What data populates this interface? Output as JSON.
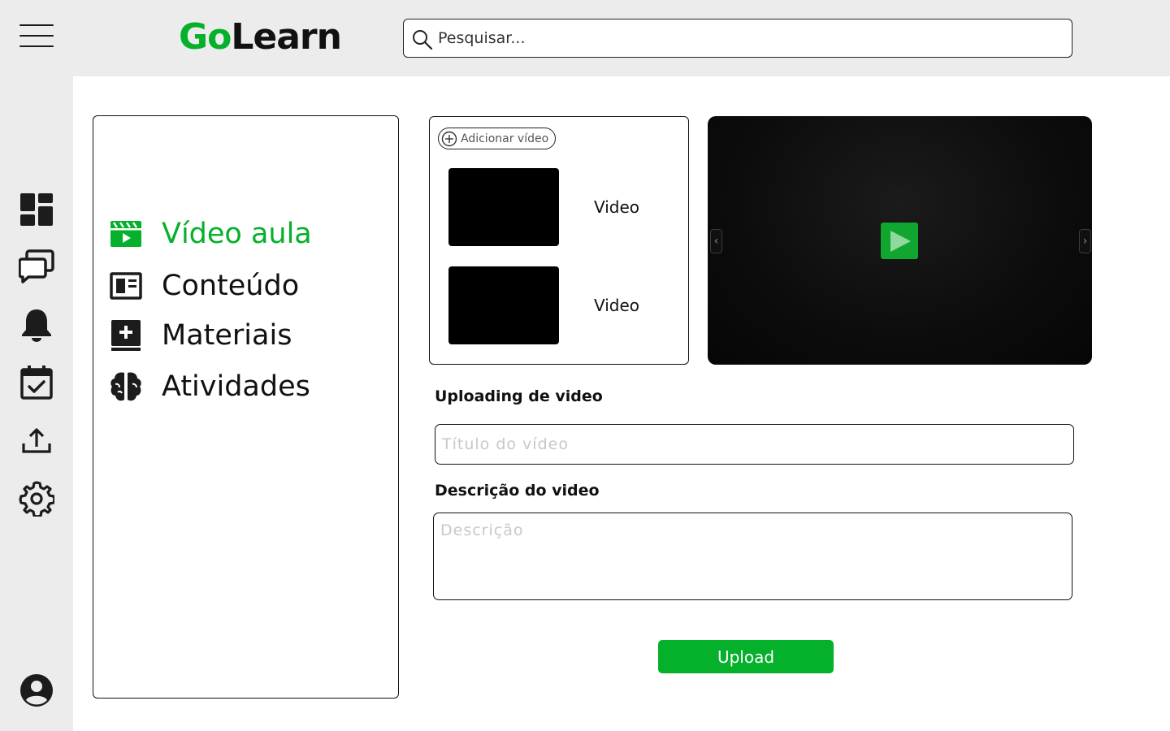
{
  "app": {
    "logo_part1": "Go",
    "logo_part2": "Learn"
  },
  "search": {
    "placeholder": "Pesquisar..."
  },
  "sidebar": {
    "icons": [
      "dashboard-icon",
      "chat-icon",
      "bell-icon",
      "calendar-check-icon",
      "upload-icon",
      "gear-icon",
      "account-icon"
    ]
  },
  "menu": {
    "items": [
      {
        "label": "Vídeo aula",
        "icon": "video-clapper-icon",
        "active": true
      },
      {
        "label": "Conteúdo",
        "icon": "article-icon",
        "active": false
      },
      {
        "label": "Materiais",
        "icon": "book-add-icon",
        "active": false
      },
      {
        "label": "Atividades",
        "icon": "brain-icon",
        "active": false
      }
    ]
  },
  "video_list": {
    "add_label": "Adicionar vídeo",
    "videos": [
      {
        "label": "Video"
      },
      {
        "label": "Video"
      }
    ]
  },
  "form": {
    "upload_heading": "Uploading de video",
    "title_placeholder": "Título do vídeo",
    "description_heading": "Descrição do video",
    "description_placeholder": "Descrição",
    "upload_label": "Upload"
  },
  "colors": {
    "accent": "#05b02a",
    "play_button": "#11a62f",
    "background": "#ececec"
  }
}
